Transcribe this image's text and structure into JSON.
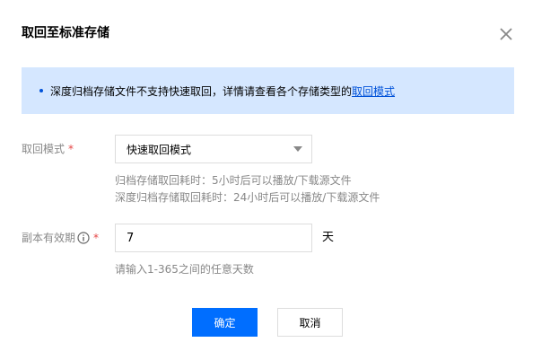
{
  "dialog": {
    "title": "取回至标准存储",
    "close_icon": "close-icon"
  },
  "notice": {
    "text": "深度归档存储文件不支持快速取回，详情请查看各个存储类型的",
    "link": "取回模式"
  },
  "mode_field": {
    "label": "取回模式",
    "required_mark": "*",
    "selected": "快速取回模式",
    "hints": [
      "归档存储取回耗时：5小时后可以播放/下载源文件",
      "深度归档存储取回耗时：24小时后可以播放/下载源文件"
    ]
  },
  "validity_field": {
    "label": "副本有效期",
    "required_mark": "*",
    "value": "7",
    "unit": "天",
    "hint": "请输入1-365之间的任意天数",
    "info_icon": "info-icon"
  },
  "actions": {
    "confirm": "确定",
    "cancel": "取消"
  },
  "colors": {
    "primary": "#006eff",
    "notice_bg": "#d5e7ff",
    "link": "#0052d9",
    "required": "#e54545"
  }
}
